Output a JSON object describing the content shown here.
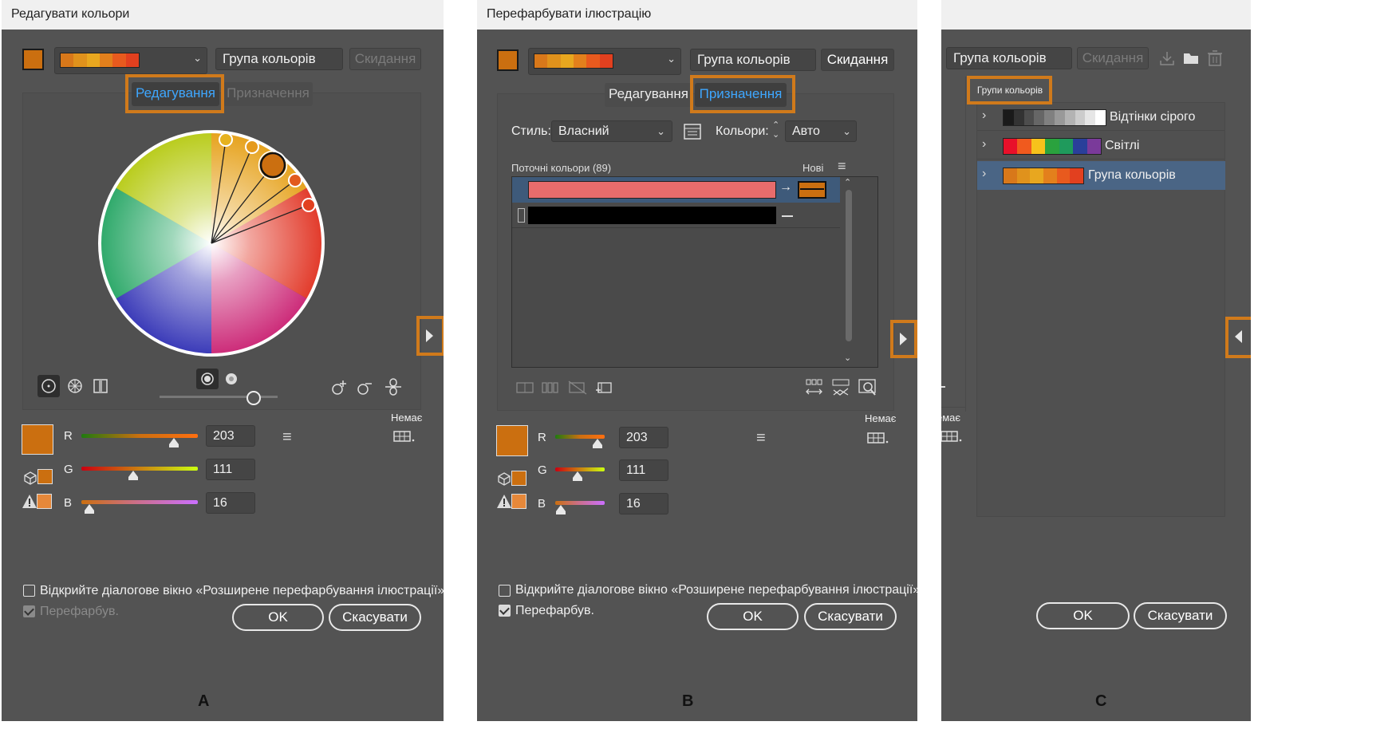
{
  "panel_a": {
    "title": "Редагувати кольори",
    "group_name": "Група кольорів",
    "reset_label": "Скидання",
    "tabs": [
      {
        "label": "Редагування",
        "active": true
      },
      {
        "label": "Призначення",
        "active": false
      }
    ],
    "none_label": "Немає",
    "rgb": [
      {
        "channel": "R",
        "value": "203"
      },
      {
        "channel": "G",
        "value": "111"
      },
      {
        "channel": "B",
        "value": "16"
      }
    ],
    "checkbox_advanced": "Відкрийте діалогове вікно «Розширене перефарбування ілюстрації»",
    "checkbox_recolor": "Перефарбув.",
    "recolor_checked": true,
    "recolor_enabled": false,
    "ok_label": "OK",
    "cancel_label": "Скасувати",
    "caption": "A"
  },
  "panel_b": {
    "title": "Перефарбувати ілюстрацію",
    "group_name": "Група кольорів",
    "reset_label": "Скидання",
    "tabs": [
      {
        "label": "Редагування",
        "active": false
      },
      {
        "label": "Призначення",
        "active": true
      }
    ],
    "style_label": "Стиль:",
    "style_value": "Власний",
    "colors_label": "Кольори:",
    "colors_value": "Авто",
    "current_colors": "Поточні кольори (89)",
    "new_label": "Нові",
    "none_label": "Немає",
    "rgb": [
      {
        "channel": "R",
        "value": "203"
      },
      {
        "channel": "G",
        "value": "111"
      },
      {
        "channel": "B",
        "value": "16"
      }
    ],
    "checkbox_advanced": "Відкрийте діалогове вікно «Розширене перефарбування ілюстрації»",
    "checkbox_recolor": "Перефарбув.",
    "recolor_checked": true,
    "ok_label": "OK",
    "cancel_label": "Скасувати",
    "caption": "B"
  },
  "panel_c": {
    "group_name": "Група кольорів",
    "reset_label": "Скидання",
    "groups_tab": "Групи кольорів",
    "groups": [
      {
        "name": "Відтінки сірого",
        "colors": [
          "#1a1a1a",
          "#333333",
          "#4d4d4d",
          "#666666",
          "#808080",
          "#999999",
          "#b3b3b3",
          "#cccccc",
          "#e6e6e6",
          "#ffffff"
        ],
        "selected": false
      },
      {
        "name": "Світлі",
        "colors": [
          "#e8102a",
          "#f05a1e",
          "#f7c21b",
          "#2aa23e",
          "#1f9a5c",
          "#2a3f9a",
          "#7a3a9a"
        ],
        "selected": false
      },
      {
        "name": "Група кольорів",
        "colors": [
          "#d8781a",
          "#e0921c",
          "#e8a71f",
          "#e3801c",
          "#e85a1e",
          "#e2401f"
        ],
        "selected": true
      }
    ],
    "none_label": "Немає",
    "ok_label": "OK",
    "cancel_label": "Скасувати",
    "caption": "C"
  },
  "colors": {
    "accent_orange": "#d07a1b",
    "base_color": "#cb6f10",
    "row_highlight_salmon": "#e86c6c",
    "selection_blue": "#3ea7ff"
  },
  "harmony_gradient": [
    "#d8781a",
    "#e0921c",
    "#e8a71f",
    "#e3801c",
    "#e85a1e",
    "#e2401f"
  ]
}
